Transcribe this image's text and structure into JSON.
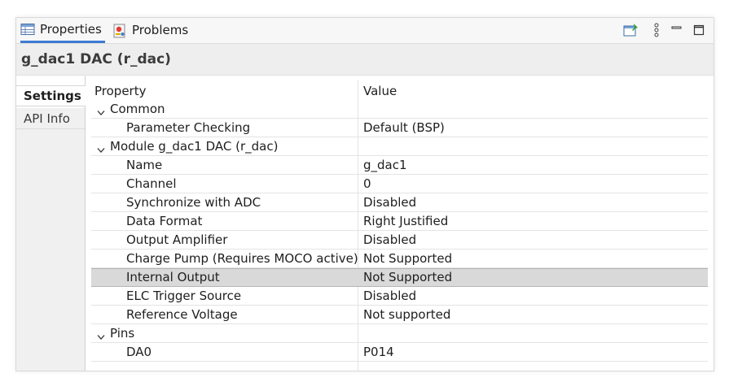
{
  "tabs": {
    "properties": "Properties",
    "problems": "Problems"
  },
  "title": "g_dac1 DAC (r_dac)",
  "side_tabs": {
    "settings": "Settings",
    "api_info": "API Info"
  },
  "table": {
    "header": {
      "property": "Property",
      "value": "Value"
    },
    "rows": [
      {
        "property": "Common",
        "value": "",
        "kind": "group"
      },
      {
        "property": "Parameter Checking",
        "value": "Default (BSP)",
        "kind": "item"
      },
      {
        "property": "Module g_dac1 DAC (r_dac)",
        "value": "",
        "kind": "group"
      },
      {
        "property": "Name",
        "value": "g_dac1",
        "kind": "item"
      },
      {
        "property": "Channel",
        "value": "0",
        "kind": "item"
      },
      {
        "property": "Synchronize with ADC",
        "value": "Disabled",
        "kind": "item"
      },
      {
        "property": "Data Format",
        "value": "Right Justified",
        "kind": "item"
      },
      {
        "property": "Output Amplifier",
        "value": "Disabled",
        "kind": "item"
      },
      {
        "property": "Charge Pump (Requires MOCO active)",
        "value": "Not Supported",
        "kind": "item"
      },
      {
        "property": "Internal Output",
        "value": "Not Supported",
        "kind": "item",
        "selected": true
      },
      {
        "property": "ELC Trigger Source",
        "value": "Disabled",
        "kind": "item"
      },
      {
        "property": "Reference Voltage",
        "value": "Not supported",
        "kind": "item"
      },
      {
        "property": "Pins",
        "value": "",
        "kind": "group"
      },
      {
        "property": "DA0",
        "value": "P014",
        "kind": "item"
      }
    ]
  },
  "icons": {
    "properties_tab": "table-icon",
    "problems_tab": "problems-icon",
    "pin": "pin-icon",
    "menu": "view-menu-icon",
    "minimize": "minimize-icon",
    "maximize": "maximize-icon",
    "expand": "chevron-down-icon"
  },
  "colors": {
    "accent": "#3d7bd1",
    "selected_row": "#d9d9d9",
    "titlebar": "#eeeeee"
  }
}
